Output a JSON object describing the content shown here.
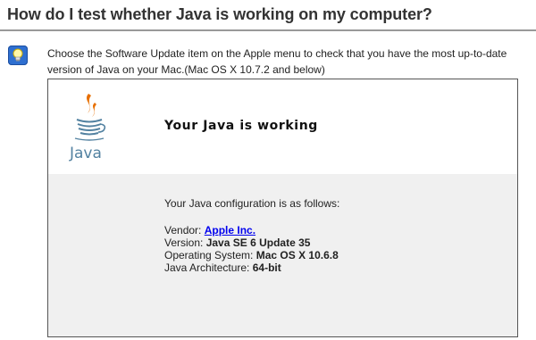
{
  "header": {
    "title": "How do I test whether Java is working on my computer?"
  },
  "tip": {
    "icon": "lightbulb-icon",
    "text": "Choose the Software Update item on the Apple menu to check that you have the most up-to-date version of Java on your Mac.(Mac OS X 10.7.2 and below)"
  },
  "panel": {
    "logo_text": "Java",
    "status": "Your Java is working",
    "config_title": "Your Java configuration is as follows:",
    "vendor_label": "Vendor:",
    "vendor_value": "Apple Inc.",
    "version_label": "Version:",
    "version_value": "Java SE 6 Update 35",
    "os_label": "Operating System:",
    "os_value": "Mac OS X 10.6.8",
    "arch_label": "Java Architecture:",
    "arch_value": "64-bit"
  },
  "colors": {
    "link": "#0000ee",
    "tip_icon_bg": "#2e6fd0",
    "java_orange": "#e76f00",
    "java_blue": "#5382a1",
    "panel_bottom_bg": "#f0f0f0"
  }
}
